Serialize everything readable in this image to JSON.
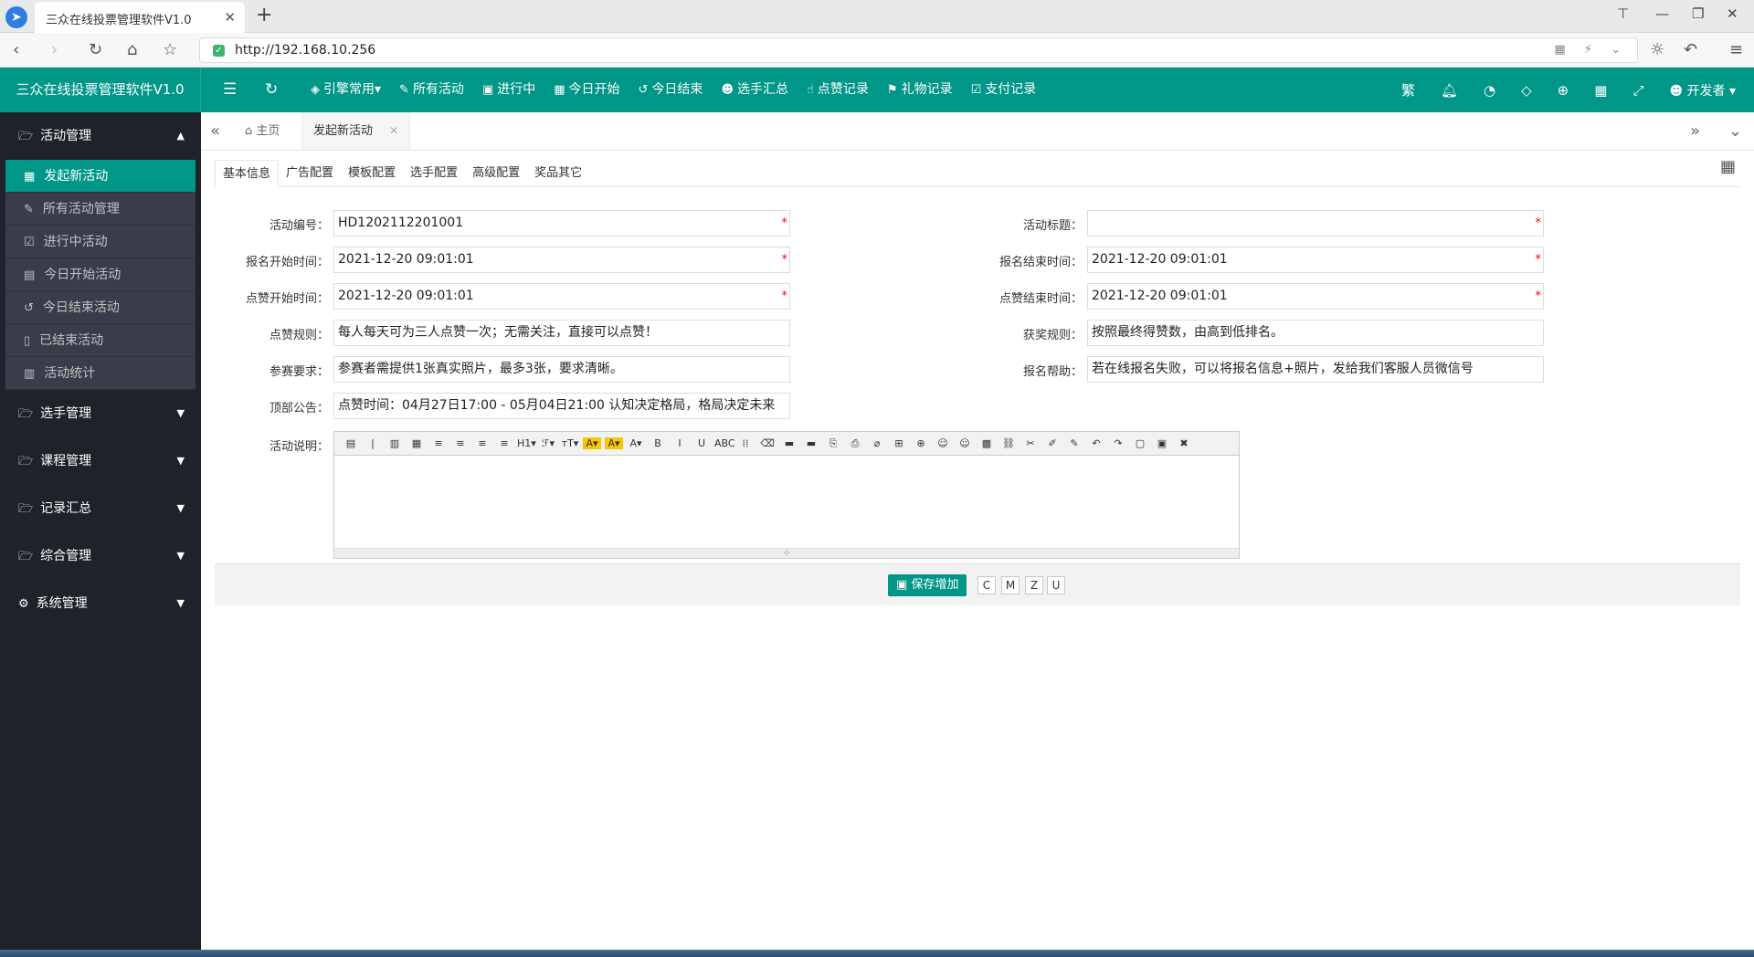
{
  "browser": {
    "tab_title": "三众在线投票管理软件V1.0",
    "url": "http://192.168.10.256"
  },
  "app": {
    "title": "三众在线投票管理软件V1.0",
    "menu": [
      {
        "label": "引擎常用",
        "icon": "layers-icon",
        "glyph": "◈",
        "caret": "▾"
      },
      {
        "label": "所有活动",
        "icon": "edit-icon",
        "glyph": "✎"
      },
      {
        "label": "进行中",
        "icon": "calendar-check-icon",
        "glyph": "▣"
      },
      {
        "label": "今日开始",
        "icon": "calendar-icon",
        "glyph": "▦"
      },
      {
        "label": "今日结束",
        "icon": "history-icon",
        "glyph": "↺"
      },
      {
        "label": "选手汇总",
        "icon": "users-icon",
        "glyph": "☻"
      },
      {
        "label": "点赞记录",
        "icon": "thumb-icon",
        "glyph": "☝"
      },
      {
        "label": "礼物记录",
        "icon": "gift-icon",
        "glyph": "⚑"
      },
      {
        "label": "支付记录",
        "icon": "check-square-icon",
        "glyph": "☑"
      }
    ],
    "right_text": "繁",
    "user": "开发者"
  },
  "sidebar": {
    "groups": [
      {
        "label": "活动管理",
        "icon": "folder-open-icon",
        "expanded": true,
        "items": [
          {
            "label": "发起新活动",
            "icon": "calendar-icon",
            "active": true
          },
          {
            "label": "所有活动管理",
            "icon": "edit-icon"
          },
          {
            "label": "进行中活动",
            "icon": "calendar-check-icon"
          },
          {
            "label": "今日开始活动",
            "icon": "calendar-grid-icon"
          },
          {
            "label": "今日结束活动",
            "icon": "history-icon"
          },
          {
            "label": "已结束活动",
            "icon": "file-icon"
          },
          {
            "label": "活动统计",
            "icon": "bar-chart-icon"
          }
        ]
      },
      {
        "label": "选手管理",
        "icon": "folder-open-icon"
      },
      {
        "label": "课程管理",
        "icon": "folder-open-icon"
      },
      {
        "label": "记录汇总",
        "icon": "folder-open-icon"
      },
      {
        "label": "综合管理",
        "icon": "folder-open-icon"
      },
      {
        "label": "系统管理",
        "icon": "cogs-icon"
      }
    ]
  },
  "page_tabs": {
    "home": "主页",
    "current": "发起新活动"
  },
  "form_tabs": [
    "基本信息",
    "广告配置",
    "模板配置",
    "选手配置",
    "高级配置",
    "奖品其它"
  ],
  "form": {
    "activity_no": {
      "label": "活动编号：",
      "value": "HD1202112201001"
    },
    "activity_title": {
      "label": "活动标题：",
      "value": ""
    },
    "signup_start": {
      "label": "报名开始时间：",
      "value": "2021-12-20 09:01:01"
    },
    "signup_end": {
      "label": "报名结束时间：",
      "value": "2021-12-20 09:01:01"
    },
    "like_start": {
      "label": "点赞开始时间：",
      "value": "2021-12-20 09:01:01"
    },
    "like_end": {
      "label": "点赞结束时间：",
      "value": "2021-12-20 09:01:01"
    },
    "like_rule": {
      "label": "点赞规则：",
      "value": "每人每天可为三人点赞一次；无需关注，直接可以点赞！"
    },
    "award_rule": {
      "label": "获奖规则：",
      "value": "按照最终得赞数，由高到低排名。"
    },
    "entry_req": {
      "label": "参赛要求：",
      "value": "参赛者需提供1张真实照片，最多3张，要求清晰。"
    },
    "signup_help": {
      "label": "报名帮助：",
      "value": "若在线报名失败，可以将报名信息+照片，发给我们客服人员微信号"
    },
    "top_notice": {
      "label": "顶部公告：",
      "value": "点赞时间：04月27日17:00 - 05月04日21:00   认知决定格局，格局决定未来"
    },
    "description": {
      "label": "活动说明："
    },
    "required_mark": "*"
  },
  "editor_toolbar": [
    "▤",
    "|",
    "▥",
    "▦",
    "≡",
    "≡",
    "≡",
    "≡",
    "H1▾",
    "ℱ▾",
    "тT▾",
    "A▾",
    "A▾",
    "A▾",
    "B",
    "I",
    "U",
    "ABC",
    "⁞⁞",
    "⌫",
    "▬",
    "▬",
    "⎘",
    "⎙",
    "⌀",
    "⊞",
    "⊕",
    "☺",
    "☺",
    "▩",
    "⛓",
    "✂",
    "✐",
    "✎",
    "↶",
    "↷",
    "▢",
    "▣",
    "✖"
  ],
  "actions": {
    "save": "保存增加",
    "small": [
      "C",
      "M",
      "Z",
      "U"
    ]
  }
}
